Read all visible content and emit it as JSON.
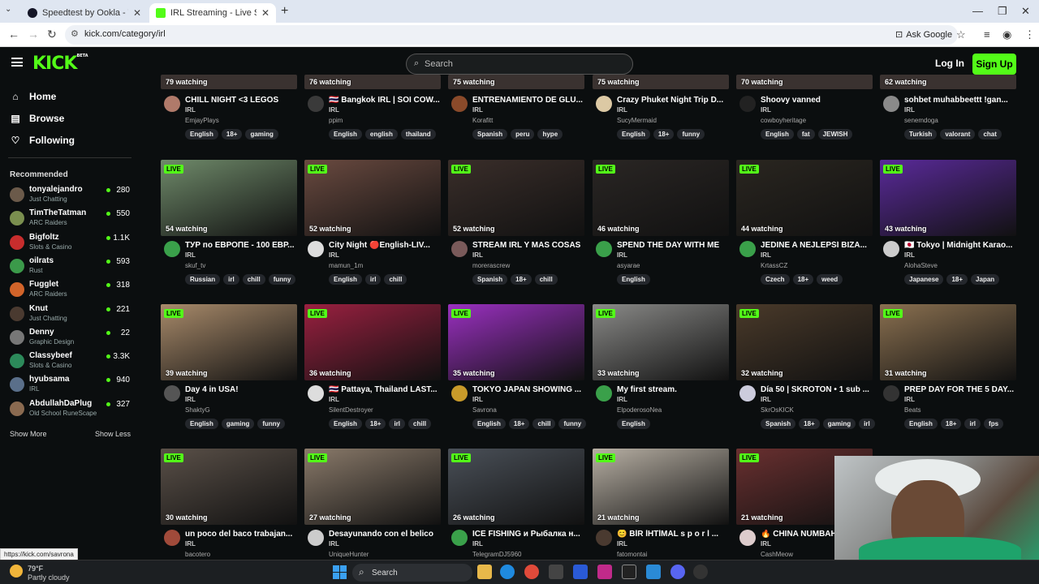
{
  "browser": {
    "tabs": [
      {
        "label": "Speedtest by Ookla - The Glob",
        "active": false
      },
      {
        "label": "IRL Streaming - Live Streams or",
        "active": true
      }
    ],
    "url": "kick.com/category/irl",
    "ask_google": "Ask Google"
  },
  "header": {
    "logo": "KICK",
    "logo_badge": "BETA",
    "search_placeholder": "Search",
    "login": "Log In",
    "signup": "Sign Up"
  },
  "sidebar": {
    "nav": [
      {
        "label": "Home",
        "icon": "home-icon"
      },
      {
        "label": "Browse",
        "icon": "browse-icon"
      },
      {
        "label": "Following",
        "icon": "heart-icon"
      }
    ],
    "recommended_title": "Recommended",
    "recommended": [
      {
        "name": "tonyalejandro",
        "category": "Just Chatting",
        "viewers": "280",
        "color": "#6b5a4a"
      },
      {
        "name": "TimTheTatman",
        "category": "ARC Raiders",
        "viewers": "550",
        "color": "#7a8f4f"
      },
      {
        "name": "Bigfoltz",
        "category": "Slots & Casino",
        "viewers": "1.1K",
        "color": "#c72d2d"
      },
      {
        "name": "oilrats",
        "category": "Rust",
        "viewers": "593",
        "color": "#3b9a4a"
      },
      {
        "name": "Fugglet",
        "category": "ARC Raiders",
        "viewers": "318",
        "color": "#d2642a"
      },
      {
        "name": "Knut",
        "category": "Just Chatting",
        "viewers": "221",
        "color": "#4a3a30"
      },
      {
        "name": "Denny",
        "category": "Graphic Design",
        "viewers": "22",
        "color": "#777"
      },
      {
        "name": "Classybeef",
        "category": "Slots & Casino",
        "viewers": "3.3K",
        "color": "#2c8a5a"
      },
      {
        "name": "hyubsama",
        "category": "IRL",
        "viewers": "940",
        "color": "#5a6f8a"
      },
      {
        "name": "AbdullahDaPlug",
        "category": "Old School RuneScape",
        "viewers": "327",
        "color": "#8a6a50"
      }
    ],
    "show_more": "Show More",
    "show_less": "Show Less"
  },
  "live_label": "LIVE",
  "top_row": [
    {
      "watching": "79 watching",
      "title": "CHILL NIGHT <3 LEGOS",
      "category": "IRL",
      "user": "EmjayPlays",
      "tags": [
        "English",
        "18+",
        "gaming"
      ],
      "av": "#b07a6a"
    },
    {
      "watching": "76 watching",
      "title": "🇹🇭 Bangkok IRL | SOI COW...",
      "category": "IRL",
      "user": "ppim",
      "tags": [
        "English",
        "english",
        "thailand"
      ],
      "av": "#3a3a3a"
    },
    {
      "watching": "75 watching",
      "title": "ENTRENAMIENTO DE GLU...",
      "category": "IRL",
      "user": "Korafitt",
      "tags": [
        "Spanish",
        "peru",
        "hype"
      ],
      "av": "#8a4a2a"
    },
    {
      "watching": "75 watching",
      "title": "Crazy Phuket Night Trip D...",
      "category": "IRL",
      "user": "SucyMermaid",
      "tags": [
        "English",
        "18+",
        "funny"
      ],
      "av": "#dcc9a4"
    },
    {
      "watching": "70 watching",
      "title": "Shoovy vanned",
      "category": "IRL",
      "user": "cowboyheritage",
      "tags": [
        "English",
        "fat",
        "JEWISH"
      ],
      "av": "#222"
    },
    {
      "watching": "62 watching",
      "title": "sohbet muhabbeettt !gan...",
      "category": "IRL",
      "user": "senemdoga",
      "tags": [
        "Turkish",
        "valorant",
        "chat"
      ],
      "av": "#8a8a8a"
    }
  ],
  "rows": [
    [
      {
        "watching": "54 watching",
        "title": "ТУР по ЕВРОПЕ - 100 ЕВР...",
        "category": "IRL",
        "user": "skuf_tv",
        "tags": [
          "Russian",
          "irl",
          "chill",
          "funny"
        ],
        "thumb": "#6f8a6a",
        "av": "#3aa04a"
      },
      {
        "watching": "52 watching",
        "title": "City Night 🔴English-LIV...",
        "category": "IRL",
        "user": "mamun_1m",
        "tags": [
          "English",
          "irl",
          "chill"
        ],
        "thumb": "#6a4a40",
        "av": "#ddd"
      },
      {
        "watching": "52 watching",
        "title": "STREAM IRL Y MAS COSAS",
        "category": "IRL",
        "user": "morerascrew",
        "tags": [
          "Spanish",
          "18+",
          "chill"
        ],
        "thumb": "#3a2e2a",
        "av": "#7a5a5a"
      },
      {
        "watching": "46 watching",
        "title": "SPEND THE DAY WITH ME",
        "category": "IRL",
        "user": "asyarae",
        "tags": [
          "English"
        ],
        "thumb": "#2a2624",
        "av": "#3aa04a"
      },
      {
        "watching": "44 watching",
        "title": "JEDINE A NEJLEPŠÍ BIZA...",
        "category": "IRL",
        "user": "KrtassCZ",
        "tags": [
          "Czech",
          "18+",
          "weed"
        ],
        "thumb": "#2a2620",
        "av": "#3aa04a"
      },
      {
        "watching": "43 watching",
        "title": "🇯🇵 Tokyo | Midnight Karao...",
        "category": "IRL",
        "user": "AlohaSteve",
        "tags": [
          "Japanese",
          "18+",
          "Japan"
        ],
        "thumb": "#5a2a9a",
        "av": "#ccc"
      }
    ],
    [
      {
        "watching": "39 watching",
        "title": "Day 4 in USA!",
        "category": "IRL",
        "user": "ShaktyG",
        "tags": [
          "English",
          "gaming",
          "funny"
        ],
        "thumb": "#a88a6a",
        "av": "#555"
      },
      {
        "watching": "36 watching",
        "title": "🇹🇭 Pattaya, Thailand LAST...",
        "category": "IRL",
        "user": "SilentDestroyer",
        "tags": [
          "English",
          "18+",
          "irl",
          "chill"
        ],
        "thumb": "#9a2040",
        "av": "#ddd"
      },
      {
        "watching": "35 watching",
        "title": "TOKYO JAPAN SHOWING ...",
        "category": "IRL",
        "user": "Savrona",
        "tags": [
          "English",
          "18+",
          "chill",
          "funny"
        ],
        "thumb": "#9a30c0",
        "av": "#c89a2a"
      },
      {
        "watching": "33 watching",
        "title": "My first stream.",
        "category": "IRL",
        "user": "ElpoderosoNea",
        "tags": [
          "English"
        ],
        "thumb": "#8a8a88",
        "av": "#3aa04a"
      },
      {
        "watching": "32 watching",
        "title": "Día 50 | SKROTON • 1 sub ...",
        "category": "IRL",
        "user": "SkrOsKICK",
        "tags": [
          "Spanish",
          "18+",
          "gaming",
          "irl"
        ],
        "thumb": "#4a3a2a",
        "av": "#ccd"
      },
      {
        "watching": "31 watching",
        "title": "PREP DAY FOR THE 5 DAY...",
        "category": "IRL",
        "user": "Beats",
        "tags": [
          "English",
          "18+",
          "irl",
          "fps"
        ],
        "thumb": "#8a7050",
        "av": "#333"
      }
    ],
    [
      {
        "watching": "30 watching",
        "title": "un poco del baco trabajan...",
        "category": "IRL",
        "user": "bacotero",
        "tags": [],
        "thumb": "#5a5048",
        "av": "#a04a3a"
      },
      {
        "watching": "27 watching",
        "title": "Desayunando con el belico",
        "category": "IRL",
        "user": "UniqueHunter",
        "tags": [],
        "thumb": "#8a7a6a",
        "av": "#ccc"
      },
      {
        "watching": "26 watching",
        "title": "ICE FISHING и Рыбалка н...",
        "category": "IRL",
        "user": "TelegramDJ5960",
        "tags": [],
        "thumb": "#4a5058",
        "av": "#3aa04a"
      },
      {
        "watching": "21 watching",
        "title": "😊 BİR İHTİMAL s p o r l ...",
        "category": "IRL",
        "user": "fatomontai",
        "tags": [],
        "thumb": "#b8b0a4",
        "av": "#4a3a30"
      },
      {
        "watching": "21 watching",
        "title": "🔥 CHINA NUMBAH",
        "category": "IRL",
        "user": "CashMeow",
        "tags": [],
        "thumb": "#6a3030",
        "av": "#dcc"
      }
    ]
  ],
  "status_link": "https://kick.com/savrona",
  "taskbar": {
    "temp": "79°F",
    "weather": "Partly cloudy",
    "search": "Search"
  }
}
